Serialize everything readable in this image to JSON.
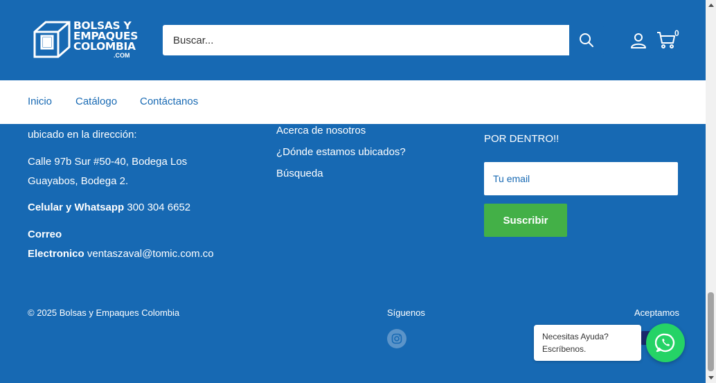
{
  "header": {
    "logo_text": [
      "BOLSAS Y",
      "EMPAQUES",
      "COLOMBIA"
    ],
    "logo_suffix": ".COM",
    "search": {
      "placeholder": "Buscar...",
      "value": ""
    },
    "cart_count": "0"
  },
  "nav": {
    "items": [
      {
        "label": "Inicio"
      },
      {
        "label": "Catálogo"
      },
      {
        "label": "Contáctanos"
      }
    ]
  },
  "footer": {
    "address_intro": "ubicado en la dirección:",
    "address_line1": "Calle 97b Sur #50-40, Bodega Los",
    "address_line2": "Guayabos, Bodega 2.",
    "phone_label": "Celular y Whatsapp",
    "phone_value": "300 304 6652",
    "email_label_1": "Correo",
    "email_label_2": "Electronico",
    "email_value": "ventaszaval@tomic.com.co",
    "links": [
      {
        "label": "Acerca de nosotros"
      },
      {
        "label": "¿Dónde estamos ubicados?"
      },
      {
        "label": "Búsqueda"
      }
    ],
    "newsletter_text": "POR DENTRO!!",
    "newsletter_input": {
      "placeholder": "Tu email",
      "value": ""
    },
    "subscribe_label": "Suscribir",
    "copyright": "© 2025 Bolsas y Empaques Colombia",
    "follow_label": "Síguenos",
    "accept_label": "Aceptamos"
  },
  "whatsapp": {
    "line1": "Necesitas Ayuda?",
    "line2": "Escríbenos.",
    "color": "#25d366"
  },
  "colors": {
    "brand_blue": "#1769b3",
    "subscribe_green": "#43b047"
  }
}
